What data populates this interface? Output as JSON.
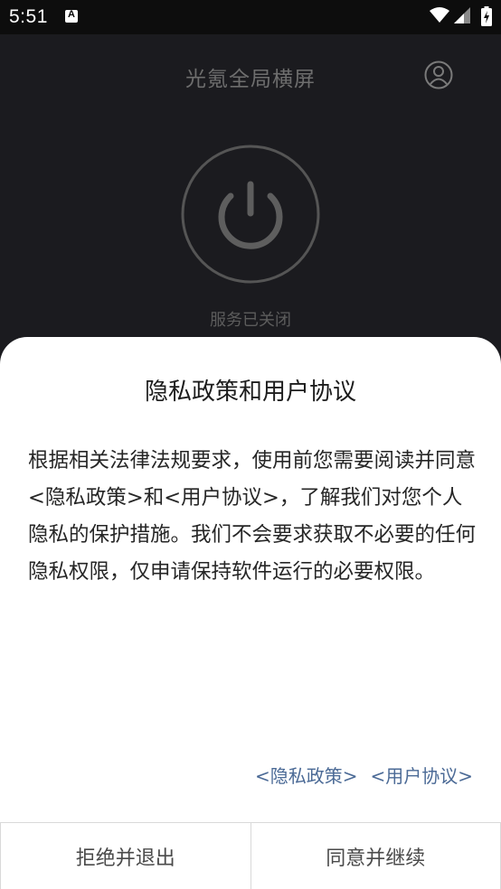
{
  "status_bar": {
    "time": "5:51",
    "notification_icon": "A",
    "icons": [
      "text-a-icon",
      "wifi-icon",
      "signal-icon",
      "battery-charging-icon"
    ]
  },
  "app": {
    "title": "光氪全局横屏",
    "service_status": "服务已关闭",
    "icons": [
      "account-icon",
      "power-icon"
    ]
  },
  "dialog": {
    "title": "隐私政策和用户协议",
    "body": "根据相关法律法规要求，使用前您需要阅读并同意<隐私政策>和<用户协议>，了解我们对您个人隐私的保护措施。我们不会要求获取不必要的任何隐私权限，仅申请保持软件运行的必要权限。",
    "links": {
      "privacy_policy": "<隐私政策>",
      "user_agreement": "<用户协议>"
    },
    "buttons": {
      "decline": "拒绝并退出",
      "accept": "同意并继续"
    }
  },
  "colors": {
    "status_bar_bg": "#0d0d0d",
    "app_bg": "#1b1b1f",
    "link": "#4b6a96",
    "sheet_bg": "#ffffff"
  }
}
